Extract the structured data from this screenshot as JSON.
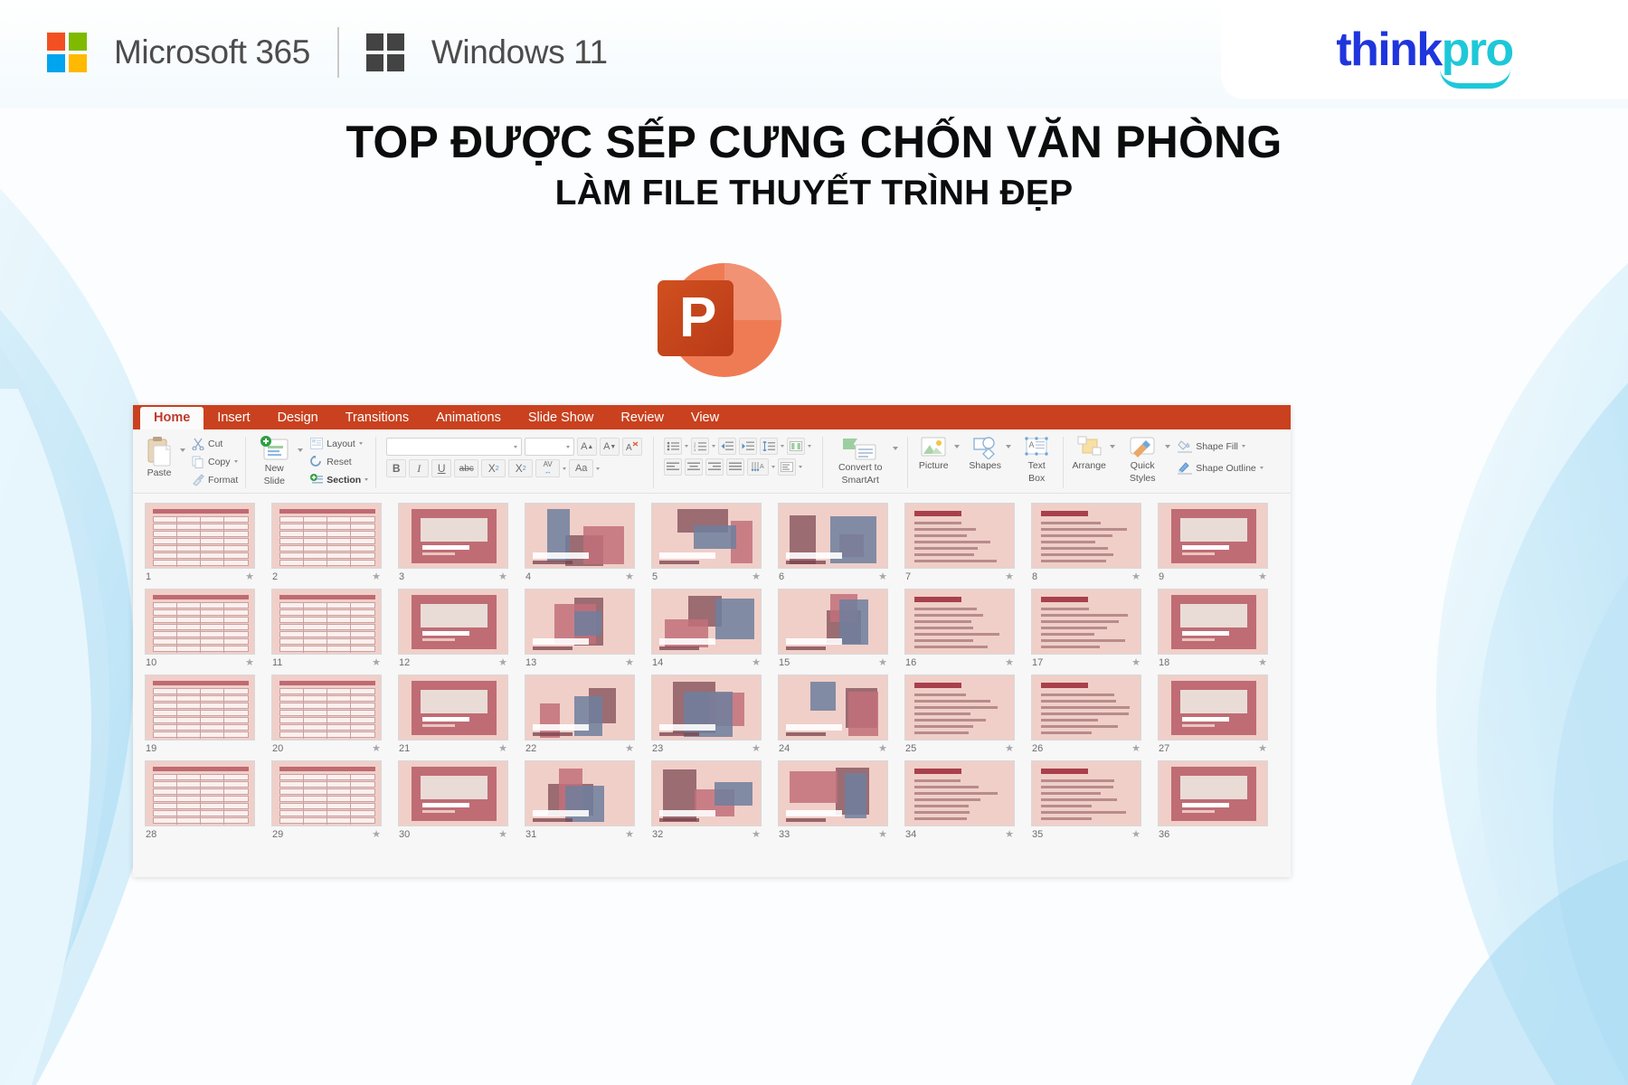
{
  "header": {
    "microsoft_label": "Microsoft 365",
    "windows_label": "Windows 11",
    "logo": {
      "think": "think",
      "pro": "pro"
    }
  },
  "headline": {
    "line1": "TOP ĐƯỢC SẾP CƯNG CHỐN VĂN PHÒNG",
    "line2": "LÀM FILE THUYẾT TRÌNH ĐẸP"
  },
  "app_icon": {
    "letter": "P",
    "name": "powerpoint-icon",
    "color": "#c8431f",
    "accent": "#ed7153"
  },
  "powerpoint": {
    "tabs": [
      {
        "label": "Home",
        "active": true
      },
      {
        "label": "Insert",
        "active": false
      },
      {
        "label": "Design",
        "active": false
      },
      {
        "label": "Transitions",
        "active": false
      },
      {
        "label": "Animations",
        "active": false
      },
      {
        "label": "Slide Show",
        "active": false
      },
      {
        "label": "Review",
        "active": false
      },
      {
        "label": "View",
        "active": false
      }
    ],
    "ribbon": {
      "clipboard": {
        "paste": "Paste",
        "cut": "Cut",
        "copy": "Copy",
        "format": "Format"
      },
      "slides": {
        "new_slide": "New\nSlide",
        "new_slide_l1": "New",
        "new_slide_l2": "Slide",
        "layout": "Layout",
        "reset": "Reset",
        "section": "Section"
      },
      "font": {
        "font_name": "",
        "font_size": "",
        "grow": "A",
        "shrink": "A",
        "clear": "A",
        "bold": "B",
        "italic": "I",
        "underline": "U",
        "strike": "abc",
        "superscript": "X",
        "sup_num": "2",
        "subscript": "X",
        "sub_num": "2",
        "spacing": "AV",
        "case": "Aa"
      },
      "paragraph": {
        "note": "bullets, numbering, indent, line spacing, columns, align, text direction, align text"
      },
      "smartart": {
        "l1": "Convert to",
        "l2": "SmartArt"
      },
      "insert": {
        "picture": "Picture",
        "shapes": "Shapes",
        "textbox_l1": "Text",
        "textbox_l2": "Box"
      },
      "drawing": {
        "arrange": "Arrange",
        "quick_l1": "Quick",
        "quick_l2": "Styles",
        "shape_fill": "Shape Fill",
        "shape_outline": "Shape Outline"
      }
    },
    "slides": [
      {
        "n": "1",
        "starred": true
      },
      {
        "n": "2",
        "starred": true
      },
      {
        "n": "3",
        "starred": true
      },
      {
        "n": "4",
        "starred": true
      },
      {
        "n": "5",
        "starred": true
      },
      {
        "n": "6",
        "starred": true
      },
      {
        "n": "7",
        "starred": true
      },
      {
        "n": "8",
        "starred": true
      },
      {
        "n": "9",
        "starred": true
      },
      {
        "n": "10",
        "starred": true
      },
      {
        "n": "11",
        "starred": true
      },
      {
        "n": "12",
        "starred": true
      },
      {
        "n": "13",
        "starred": true
      },
      {
        "n": "14",
        "starred": true
      },
      {
        "n": "15",
        "starred": true
      },
      {
        "n": "16",
        "starred": true
      },
      {
        "n": "17",
        "starred": true
      },
      {
        "n": "18",
        "starred": true
      },
      {
        "n": "19",
        "starred": false
      },
      {
        "n": "20",
        "starred": true
      },
      {
        "n": "21",
        "starred": true
      },
      {
        "n": "22",
        "starred": true
      },
      {
        "n": "23",
        "starred": true
      },
      {
        "n": "24",
        "starred": true
      },
      {
        "n": "25",
        "starred": true
      },
      {
        "n": "26",
        "starred": true
      },
      {
        "n": "27",
        "starred": true
      },
      {
        "n": "28",
        "starred": false
      },
      {
        "n": "29",
        "starred": true
      },
      {
        "n": "30",
        "starred": true
      },
      {
        "n": "31",
        "starred": true
      },
      {
        "n": "32",
        "starred": true
      },
      {
        "n": "33",
        "starred": true
      },
      {
        "n": "34",
        "starred": true
      },
      {
        "n": "35",
        "starred": true
      },
      {
        "n": "36",
        "starred": false
      }
    ],
    "star_glyph": "★"
  },
  "colors": {
    "ribbon_red": "#c9411f",
    "tab_text_active": "#c0392b",
    "slide_bg": "#f0cfc9",
    "bg_wave": "#bfe4f6",
    "brand_blue": "#1f35dd",
    "brand_cyan": "#1ec8d8"
  }
}
